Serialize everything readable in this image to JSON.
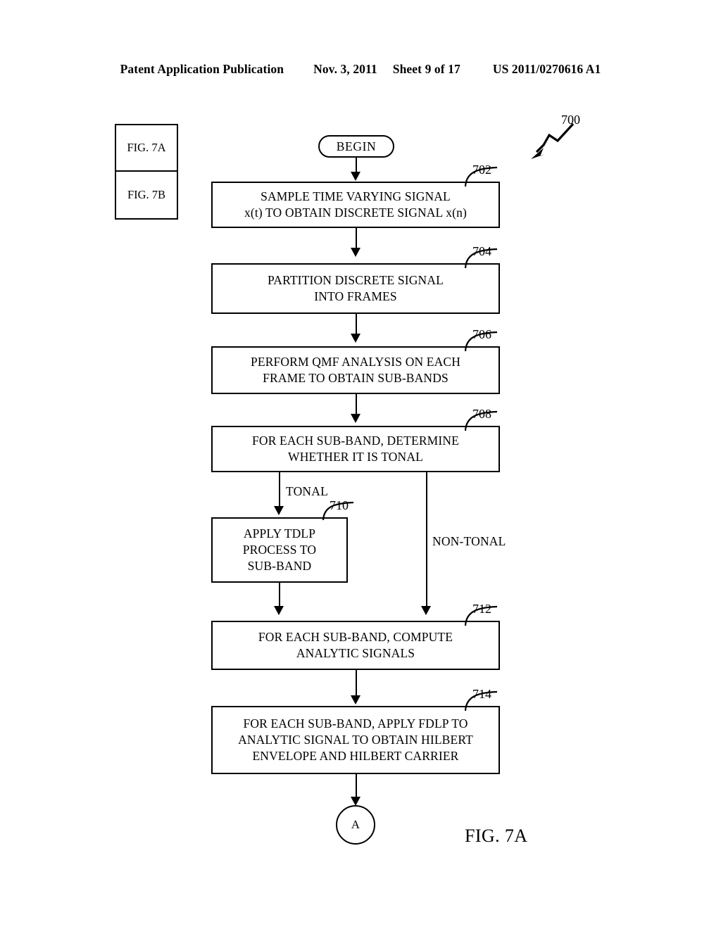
{
  "header": {
    "publication": "Patent Application Publication",
    "date": "Nov. 3, 2011",
    "sheet": "Sheet 9 of 17",
    "patent_number": "US 2011/0270616 A1"
  },
  "key_box": {
    "top_label": "FIG. 7A",
    "bottom_label": "FIG. 7B"
  },
  "figure": {
    "caption": "FIG. 7A",
    "overall_ref": "700"
  },
  "flowchart": {
    "begin_label": "BEGIN",
    "connector_label": "A",
    "nodes": [
      {
        "ref": "702",
        "text": "SAMPLE TIME VARYING SIGNAL\nx(t) TO OBTAIN DISCRETE SIGNAL x(n)"
      },
      {
        "ref": "704",
        "text": "PARTITION DISCRETE SIGNAL\nINTO FRAMES"
      },
      {
        "ref": "706",
        "text": "PERFORM QMF ANALYSIS ON EACH\nFRAME TO OBTAIN SUB-BANDS"
      },
      {
        "ref": "708",
        "text": "FOR EACH SUB-BAND, DETERMINE\nWHETHER IT IS TONAL"
      },
      {
        "ref": "710",
        "text": "APPLY TDLP\nPROCESS TO\nSUB-BAND"
      },
      {
        "ref": "712",
        "text": "FOR EACH SUB-BAND, COMPUTE\nANALYTIC SIGNALS"
      },
      {
        "ref": "714",
        "text": "FOR EACH SUB-BAND, APPLY FDLP TO\nANALYTIC SIGNAL TO OBTAIN HILBERT\nENVELOPE AND HILBERT CARRIER"
      }
    ],
    "branch_labels": {
      "tonal": "TONAL",
      "non_tonal": "NON-TONAL"
    }
  }
}
